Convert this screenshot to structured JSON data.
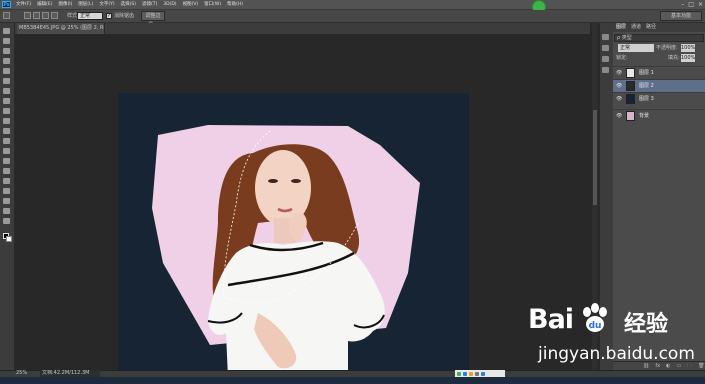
{
  "app": {
    "logo": "Ps",
    "menu": [
      "文件(F)",
      "编辑(E)",
      "图像(I)",
      "图层(L)",
      "文字(Y)",
      "选择(S)",
      "滤镜(T)",
      "3D(D)",
      "视图(V)",
      "窗口(W)",
      "帮助(H)"
    ],
    "window_controls": [
      "–",
      "□",
      "×"
    ]
  },
  "options": {
    "style_label": "样式:",
    "style_value": "正常",
    "antialias_label": "消除锯齿",
    "antialias_checked": "✓",
    "refine_edge_button": "调整边缘...",
    "workspace": "基本功能"
  },
  "document": {
    "tab_title": "MB53B4E45.JPG @ 25% (图层 2, RGB/8) *",
    "zoom": "25%",
    "doc_info": "文档:42.2M/112.3M"
  },
  "layers": {
    "tabs": [
      "图层",
      "通道",
      "路径"
    ],
    "filter": "ρ 类型",
    "blend_mode": "正常",
    "opacity_label": "不透明度:",
    "opacity": "100%",
    "lock_label": "锁定:",
    "fill_label": "填充:",
    "fill": "100%",
    "items": [
      {
        "name": "图层 1",
        "eye": "👁"
      },
      {
        "name": "图层 2",
        "eye": "👁"
      },
      {
        "name": "图层 3",
        "eye": "👁"
      },
      {
        "name": "背景",
        "eye": "👁"
      }
    ],
    "bottom_icons": [
      "⛓",
      "fx",
      "◐",
      "▭",
      "🗀",
      "🗑"
    ]
  },
  "watermark": {
    "logo": "Bai",
    "logo_suffix": "du",
    "cn": "经验",
    "url": "jingyan.baidu.com"
  },
  "colors": {
    "canvas_bg": "#172434",
    "pink_shape": "#efd0e6",
    "accent": "#31a8ff",
    "selected_layer": "#5f6f89"
  }
}
